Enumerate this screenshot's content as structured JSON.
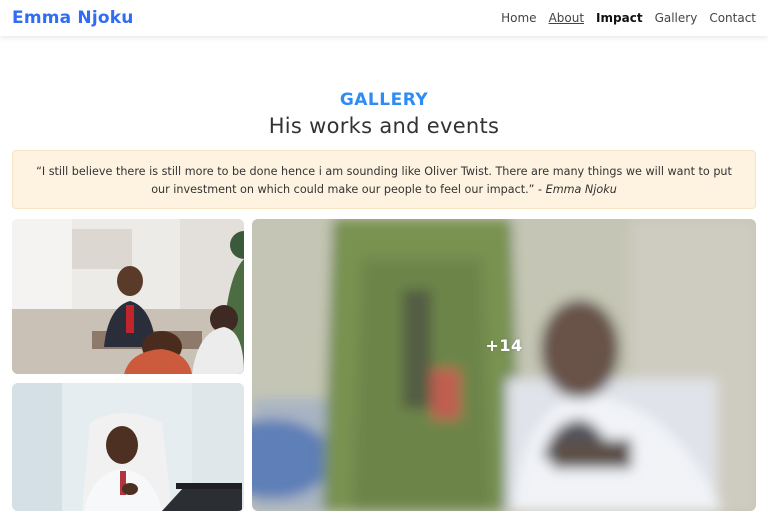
{
  "navbar": {
    "brand": "Emma Njoku",
    "links": [
      {
        "label": "Home"
      },
      {
        "label": "About"
      },
      {
        "label": "Impact"
      },
      {
        "label": "Gallery"
      },
      {
        "label": "Contact"
      }
    ]
  },
  "gallery": {
    "kicker": "GALLERY",
    "title": "His works and events",
    "quote": {
      "text": "“I still believe there is still more to be done hence i am sounding like Oliver Twist. There are many things we will want to put our investment on which could make our people to feel our impact.” -",
      "author": "Emma Njoku"
    },
    "more_count": "+14"
  }
}
